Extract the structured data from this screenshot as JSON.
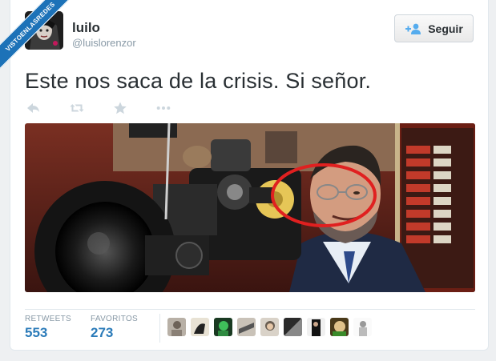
{
  "ribbon": {
    "label": "VISTOENLASREDES"
  },
  "tweet": {
    "display_name": "luilo",
    "handle": "@luislorenzor",
    "text": "Este nos saca de la crisis. Si señor.",
    "follow_label": "Seguir"
  },
  "actions": [
    {
      "name": "reply-icon"
    },
    {
      "name": "retweet-icon"
    },
    {
      "name": "favorite-icon"
    },
    {
      "name": "more-icon"
    }
  ],
  "stats": {
    "retweets_label": "RETWEETS",
    "retweets_value": "553",
    "favorites_label": "FAVORITOS",
    "favorites_value": "273"
  },
  "colors": {
    "accent": "#2b7bb9",
    "ribbon": "#1d72b8",
    "highlight_circle": "#e02020"
  },
  "favoriters_count_shown": 9
}
